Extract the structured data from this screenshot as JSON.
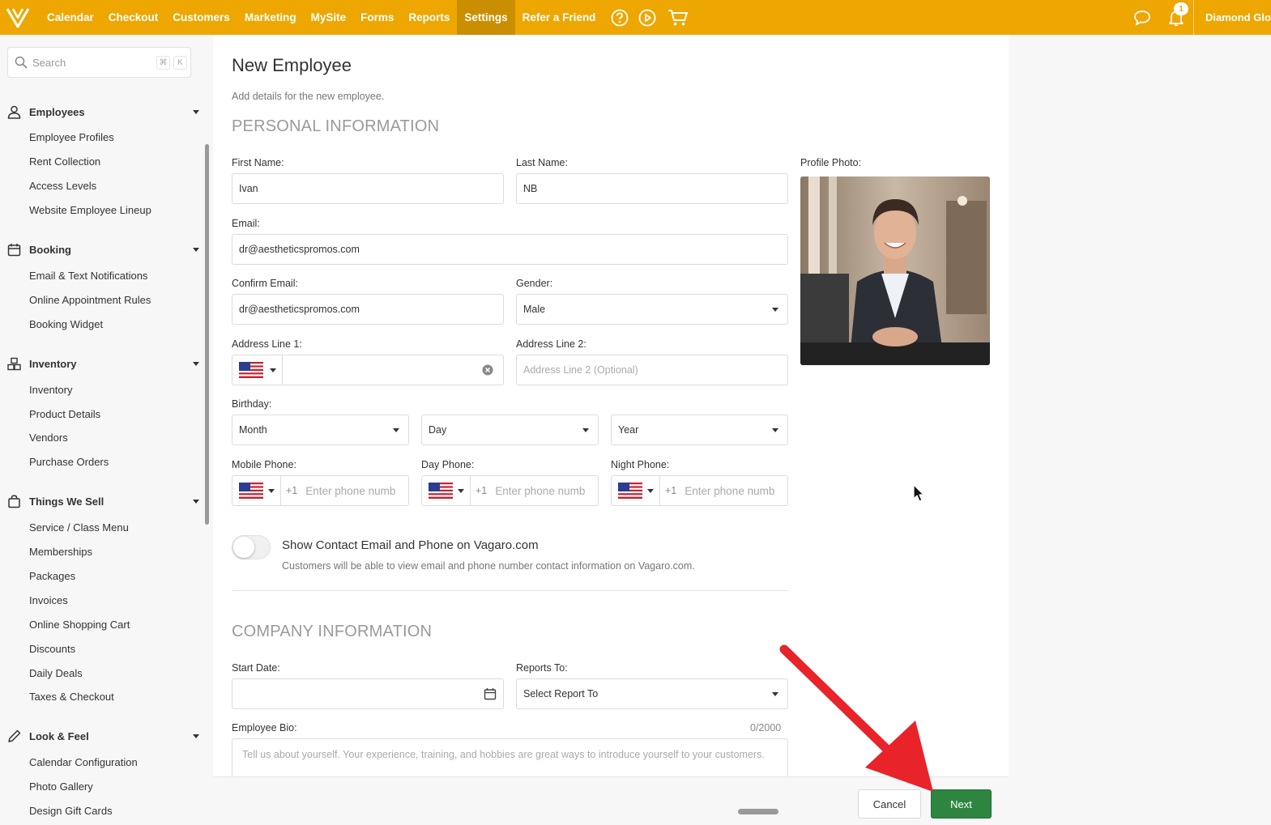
{
  "nav": {
    "items": [
      "Calendar",
      "Checkout",
      "Customers",
      "Marketing",
      "MySite",
      "Forms",
      "Reports",
      "Settings",
      "Refer a Friend"
    ],
    "active": "Settings",
    "notification_count": "1",
    "account_name": "Diamond Glo"
  },
  "sidebar": {
    "search_placeholder": "Search",
    "shortcut_keys": [
      "⌘",
      "K"
    ],
    "sections": [
      {
        "label": "Employees",
        "icon": "person-icon",
        "items": [
          "Employee Profiles",
          "Rent Collection",
          "Access Levels",
          "Website Employee Lineup"
        ]
      },
      {
        "label": "Booking",
        "icon": "calendar-icon",
        "items": [
          "Email & Text Notifications",
          "Online Appointment Rules",
          "Booking Widget"
        ]
      },
      {
        "label": "Inventory",
        "icon": "boxes-icon",
        "items": [
          "Inventory",
          "Product Details",
          "Vendors",
          "Purchase Orders"
        ]
      },
      {
        "label": "Things We Sell",
        "icon": "bag-icon",
        "items": [
          "Service / Class Menu",
          "Memberships",
          "Packages",
          "Invoices",
          "Online Shopping Cart",
          "Discounts",
          "Daily Deals",
          "Taxes & Checkout"
        ]
      },
      {
        "label": "Look & Feel",
        "icon": "pencil-icon",
        "items": [
          "Calendar Configuration",
          "Photo Gallery",
          "Design Gift Cards"
        ]
      }
    ]
  },
  "form": {
    "title": "New Employee",
    "subtitle": "Add details for the new employee.",
    "personal_heading": "PERSONAL INFORMATION",
    "first_name": {
      "label": "First Name:",
      "value": "Ivan"
    },
    "last_name": {
      "label": "Last Name:",
      "value": "NB"
    },
    "profile_photo_label": "Profile Photo:",
    "email": {
      "label": "Email:",
      "value": "dr@aestheticspromos.com"
    },
    "confirm_email": {
      "label": "Confirm Email:",
      "value": "dr@aestheticspromos.com"
    },
    "gender": {
      "label": "Gender:",
      "value": "Male"
    },
    "address1": {
      "label": "Address Line 1:",
      "value": ""
    },
    "address2": {
      "label": "Address Line 2:",
      "placeholder": "Address Line 2 (Optional)"
    },
    "birthday": {
      "label": "Birthday:",
      "month": "Month",
      "day": "Day",
      "year": "Year"
    },
    "mobile_phone": {
      "label": "Mobile Phone:",
      "code": "+1",
      "placeholder": "Enter phone numb"
    },
    "day_phone": {
      "label": "Day Phone:",
      "code": "+1",
      "placeholder": "Enter phone numb"
    },
    "night_phone": {
      "label": "Night Phone:",
      "code": "+1",
      "placeholder": "Enter phone numb"
    },
    "toggle_title": "Show Contact Email and Phone on Vagaro.com",
    "toggle_desc": "Customers will be able to view email and phone number contact information on Vagaro.com.",
    "toggle_on": false,
    "company_heading": "COMPANY INFORMATION",
    "start_date": {
      "label": "Start Date:",
      "value": ""
    },
    "reports_to": {
      "label": "Reports To:",
      "value": "Select Report To"
    },
    "bio": {
      "label": "Employee Bio:",
      "counter": "0/2000",
      "placeholder": "Tell us about yourself. Your experience, training, and hobbies are great ways to introduce yourself to your customers."
    }
  },
  "footer": {
    "cancel": "Cancel",
    "next": "Next"
  },
  "colors": {
    "brand": "#eda700",
    "next_button": "#2e8540",
    "annotation_arrow": "#e8232a"
  }
}
